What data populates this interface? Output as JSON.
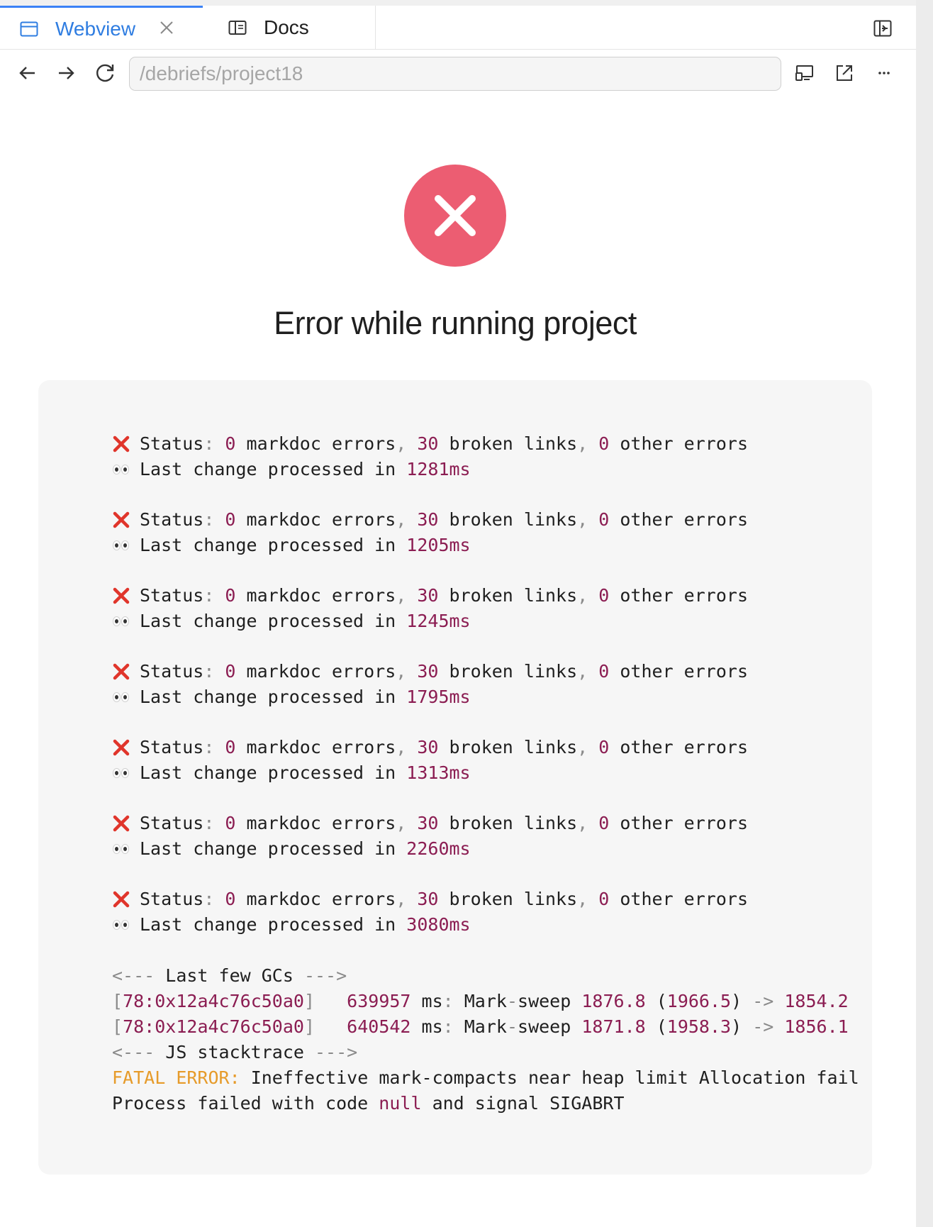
{
  "tabs": [
    {
      "label": "Webview",
      "icon": "browser-window-icon",
      "active": true
    },
    {
      "label": "Docs",
      "icon": "book-icon",
      "active": false
    }
  ],
  "nav": {
    "url": "/debriefs/project18"
  },
  "error": {
    "title": "Error while running project",
    "icon": "close-x-icon"
  },
  "status": {
    "prefix": "Status",
    "markdoc_count": "0",
    "markdoc_text": "markdoc errors",
    "broken_count": "30",
    "broken_text": "broken links",
    "other_count": "0",
    "other_text": "other errors",
    "change_text": "Last change processed in"
  },
  "timings": [
    "1281ms",
    "1205ms",
    "1245ms",
    "1795ms",
    "1313ms",
    "2260ms",
    "3080ms"
  ],
  "gc": {
    "header_open": "<---",
    "header_label": "Last few GCs",
    "header_close": "--->",
    "lines": [
      {
        "pid": "78",
        "addr": "0x12a4c76c50a0",
        "time": "639957",
        "unit": "ms",
        "kind_a": "Mark",
        "kind_b": "sweep",
        "before": "1876.8",
        "paren": "1966.5",
        "after": "1854.2"
      },
      {
        "pid": "78",
        "addr": "0x12a4c76c50a0",
        "time": "640542",
        "unit": "ms",
        "kind_a": "Mark",
        "kind_b": "sweep",
        "before": "1871.8",
        "paren": "1958.3",
        "after": "1856.1"
      }
    ],
    "stack_label": "JS stacktrace"
  },
  "fatal": {
    "word1": "FATAL",
    "word2": "ERROR",
    "message": "Ineffective mark-compacts near heap limit Allocation failed - JavaScript heap out of memory",
    "process_prefix": "Process failed with code",
    "code": "null",
    "signal_text": "and signal SIGABRT"
  },
  "colors": {
    "accent": "#2f7de1",
    "error": "#ec5d72",
    "number": "#8b1d52",
    "warn": "#e69b2a"
  }
}
